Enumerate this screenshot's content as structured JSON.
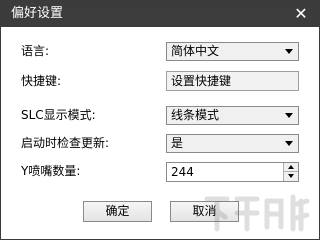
{
  "window": {
    "title": "偏好设置",
    "close_glyph": "✕"
  },
  "form": {
    "language": {
      "label": "语言:",
      "value": "简体中文"
    },
    "shortcut": {
      "label": "快捷键:",
      "value": "设置快捷键"
    },
    "slc_mode": {
      "label": "SLC显示模式:",
      "value": "线条模式"
    },
    "check_update": {
      "label": "启动时检查更新:",
      "value": "是"
    },
    "nozzle_count": {
      "label": "Y喷嘴数量:",
      "value": "244"
    }
  },
  "buttons": {
    "ok": "确定",
    "cancel": "取消"
  },
  "colors": {
    "titlebar": "#3c3c3c",
    "title_text": "#ffffff"
  },
  "icons": {
    "close": "close-icon",
    "dropdown": "chevron-down-icon",
    "spin_up": "spin-up-icon",
    "spin_down": "spin-down-icon",
    "watermark": "watermark-logo"
  }
}
